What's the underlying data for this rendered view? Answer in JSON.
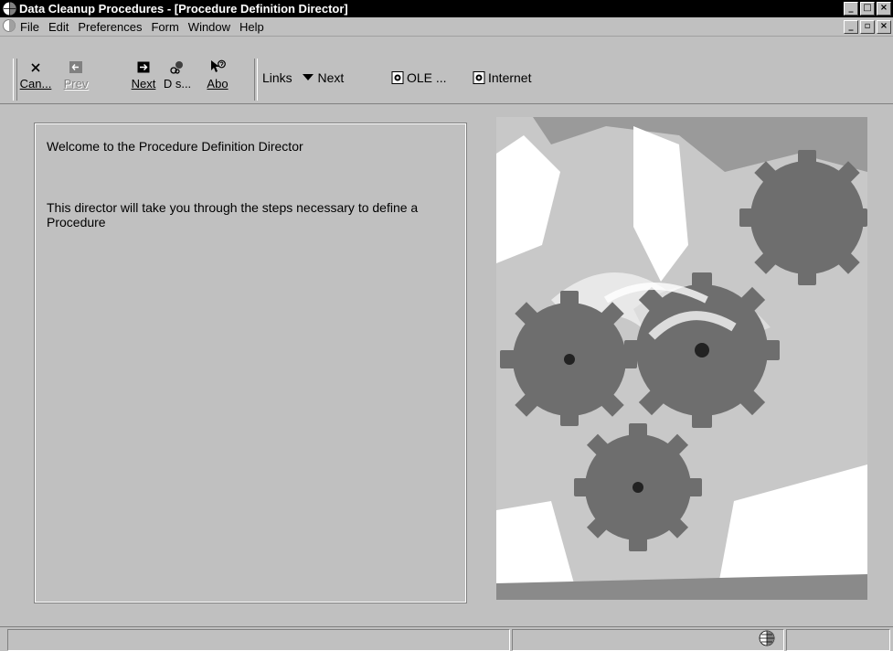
{
  "window": {
    "title": "Data Cleanup Procedures - [Procedure Definition Director]",
    "controls": [
      "_",
      "□",
      "×"
    ]
  },
  "menubar": {
    "items": [
      "File",
      "Edit",
      "Preferences",
      "Form",
      "Window",
      "Help"
    ],
    "child_controls": [
      "_",
      "▫",
      "×"
    ]
  },
  "toolbar": {
    "cancel_label": "Can...",
    "prev_label": "Prev",
    "next_label": "Next",
    "ds_label": "D s...",
    "about_label": "Abo",
    "links_label": "Links",
    "links_next_label": "Next",
    "ole_label": "OLE ...",
    "internet_label": "Internet"
  },
  "content": {
    "welcome": "Welcome to the Procedure Definition Director",
    "description": "This director will take you through the steps necessary to define a Procedure"
  },
  "colors": {
    "titlebar": "#000000",
    "background": "#c0c0c0",
    "gear": "#6e6e6e"
  },
  "icons": {
    "app": "globe-icon",
    "cancel": "close-icon",
    "prev": "arrow-left-icon",
    "next": "arrow-right-icon",
    "ds": "gear-icon",
    "about": "help-pointer-icon"
  }
}
